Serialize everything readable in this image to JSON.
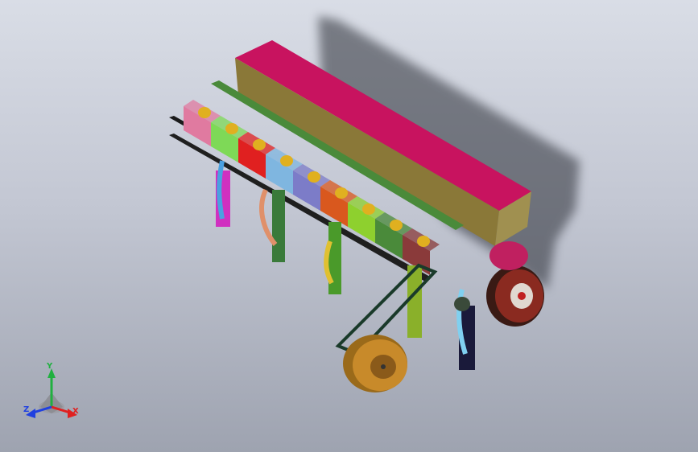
{
  "viewport": {
    "background_top": "#d9dde6",
    "background_bottom": "#9ea3b0"
  },
  "model": {
    "hopper_color": "#c8135f",
    "hopper_front_color": "#8a7838",
    "frame_color": "#1a1a1a",
    "seed_box_colors": [
      "#e07aa0",
      "#7ed957",
      "#e02020",
      "#7fb6e0",
      "#7c7cc8",
      "#d9581e",
      "#8ed02e",
      "#4a8a3a",
      "#8a3a3a"
    ],
    "wheel_color": "#c88a2a",
    "drive_wheel_color": "#8a2a20"
  },
  "triad": {
    "x_label": "X",
    "y_label": "Y",
    "z_label": "Z",
    "x_color": "#e02020",
    "y_color": "#20b040",
    "z_color": "#2040e0"
  }
}
